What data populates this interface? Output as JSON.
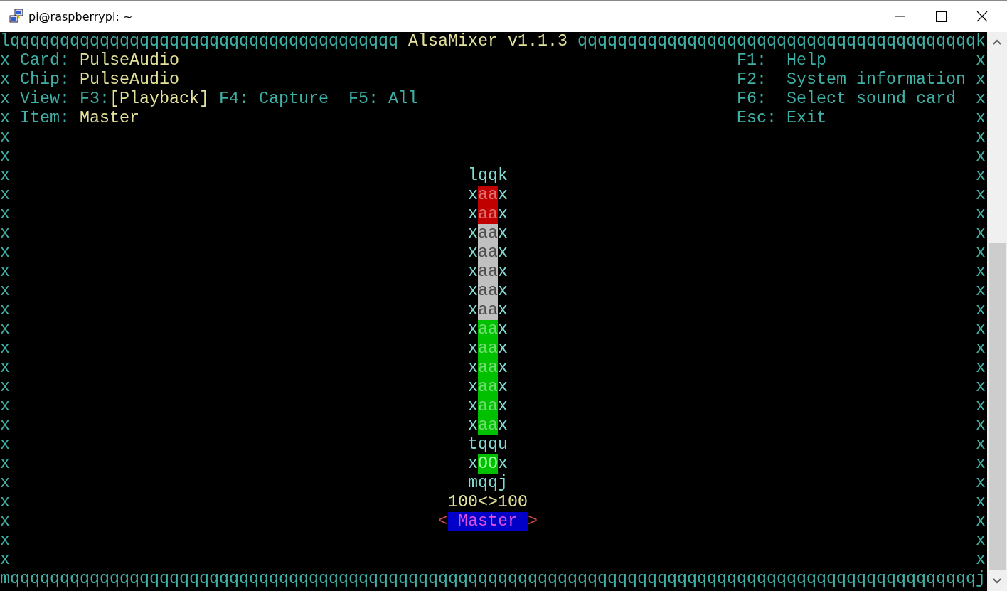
{
  "window": {
    "title": "pi@raspberrypi: ~"
  },
  "mixer": {
    "frame": {
      "top_left": "lqqqqqqqqqqqqqqqqqqqqqqqqqqqqqqqqqqqqqqq",
      "title": "AlsaMixer v1.1.3",
      "top_right": "qqqqqqqqqqqqqqqqqqqqqqqqqqqqqqqqqqqqqqqqk",
      "left_edge": [
        "x",
        "x",
        "x",
        "x",
        "x",
        "x",
        "x",
        "x",
        "x",
        "x",
        "x",
        "x",
        "x",
        "x",
        "x",
        "x",
        "x",
        "x",
        "x",
        "x",
        "x",
        "x",
        "x",
        "x",
        "x",
        "x",
        "x"
      ],
      "right_edge": [
        "x",
        "x",
        "x",
        "x",
        "x",
        "x",
        "x",
        "x",
        "x",
        "x",
        "x",
        "x",
        "x",
        "x",
        "x",
        "x",
        "x",
        "x",
        "x",
        "x",
        "x",
        "x",
        "x",
        "x",
        "x",
        "x",
        "x"
      ],
      "bottom": "mqqqqqqqqqqqqqqqqqqqqqqqqqqqqqqqqqqqqqqqqqqqqqqqqqqqqqqqqqqqqqqqqqqqqqqqqqqqqqqqqqqqqqqqqqqqqqqqqqj"
    },
    "info": [
      {
        "label": "Card:",
        "value": "PulseAudio"
      },
      {
        "label": "Chip:",
        "value": "PulseAudio"
      }
    ],
    "views": {
      "label": "View:",
      "items": [
        {
          "key": "F3:",
          "name": "[Playback]",
          "selected": true
        },
        {
          "key": "F4:",
          "name": "Capture",
          "selected": false
        },
        {
          "key": "F5:",
          "name": "All",
          "selected": false
        }
      ]
    },
    "item": {
      "label": "Item:",
      "value": "Master"
    },
    "keys": [
      {
        "key": "F1:",
        "action": "Help"
      },
      {
        "key": "F2:",
        "action": "System information"
      },
      {
        "key": "F6:",
        "action": "Select sound card"
      },
      {
        "key": "Esc:",
        "action": "Exit"
      }
    ],
    "control": {
      "top": "lqqk",
      "meter": [
        {
          "left": "x",
          "cells": "aa",
          "right": "x",
          "color": "#c00000"
        },
        {
          "left": "x",
          "cells": "aa",
          "right": "x",
          "color": "#c00000"
        },
        {
          "left": "x",
          "cells": "aa",
          "right": "x",
          "color": "#c0c0c0"
        },
        {
          "left": "x",
          "cells": "aa",
          "right": "x",
          "color": "#c0c0c0"
        },
        {
          "left": "x",
          "cells": "aa",
          "right": "x",
          "color": "#c0c0c0"
        },
        {
          "left": "x",
          "cells": "aa",
          "right": "x",
          "color": "#c0c0c0"
        },
        {
          "left": "x",
          "cells": "aa",
          "right": "x",
          "color": "#c0c0c0"
        },
        {
          "left": "x",
          "cells": "aa",
          "right": "x",
          "color": "#00c000"
        },
        {
          "left": "x",
          "cells": "aa",
          "right": "x",
          "color": "#00c000"
        },
        {
          "left": "x",
          "cells": "aa",
          "right": "x",
          "color": "#00c000"
        },
        {
          "left": "x",
          "cells": "aa",
          "right": "x",
          "color": "#00c000"
        },
        {
          "left": "x",
          "cells": "aa",
          "right": "x",
          "color": "#00c000"
        },
        {
          "left": "x",
          "cells": "aa",
          "right": "x",
          "color": "#00c000"
        }
      ],
      "divider": "tqqu",
      "switch": {
        "left": "x",
        "text": "OO",
        "right": "x",
        "on": true
      },
      "bottom": "mqqj",
      "values": "100<>100",
      "name": {
        "left": "<",
        "text": "Master",
        "right": ">",
        "selected": true
      }
    }
  }
}
